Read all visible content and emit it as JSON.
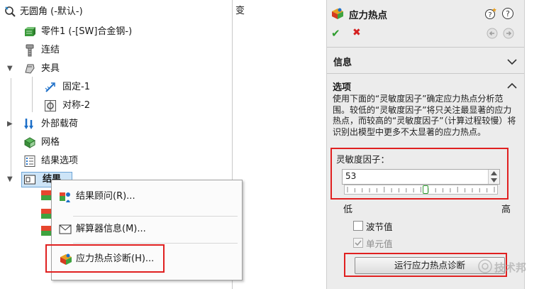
{
  "tree": {
    "root_label": "无圆角 (-默认-)",
    "part_label": "零件1 (-[SW]合金钢-)",
    "connections_label": "连结",
    "fixtures_label": "夹具",
    "fixed_label": "固定-1",
    "symmetry_label": "对称-2",
    "loads_label": "外部载荷",
    "mesh_label": "网格",
    "result_options_label": "结果选项",
    "results_label": "结果"
  },
  "context_menu": {
    "results_advisor": "结果顾问(R)...",
    "solver_info": "解算器信息(M)...",
    "hotspot_diagnostics": "应力热点诊断(H)..."
  },
  "stray_char": "变",
  "property_manager": {
    "title": "应力热点",
    "ok_symbol": "✔",
    "cancel_symbol": "✖",
    "info_section": "信息",
    "options_section": "选项",
    "description": "使用下面的“灵敏度因子”确定应力热点分析范围。较低的“灵敏度因子”将只关注最显著的应力热点，而较高的“灵敏度因子”（计算过程较慢）将识别出模型中更多不太显著的应力热点。",
    "sensitivity_label": "灵敏度因子：",
    "sensitivity_value": "53",
    "slider_level": 0.53,
    "low_label": "低",
    "high_label": "高",
    "wave_label": "波节值",
    "element_label": "单元值",
    "run_button": "运行应力热点诊断"
  },
  "watermark": "技术邦",
  "colors": {
    "highlight": "#e02020",
    "selection": "#cde4f7",
    "ok_green": "#2e9d2e",
    "cancel_red": "#d42020"
  }
}
